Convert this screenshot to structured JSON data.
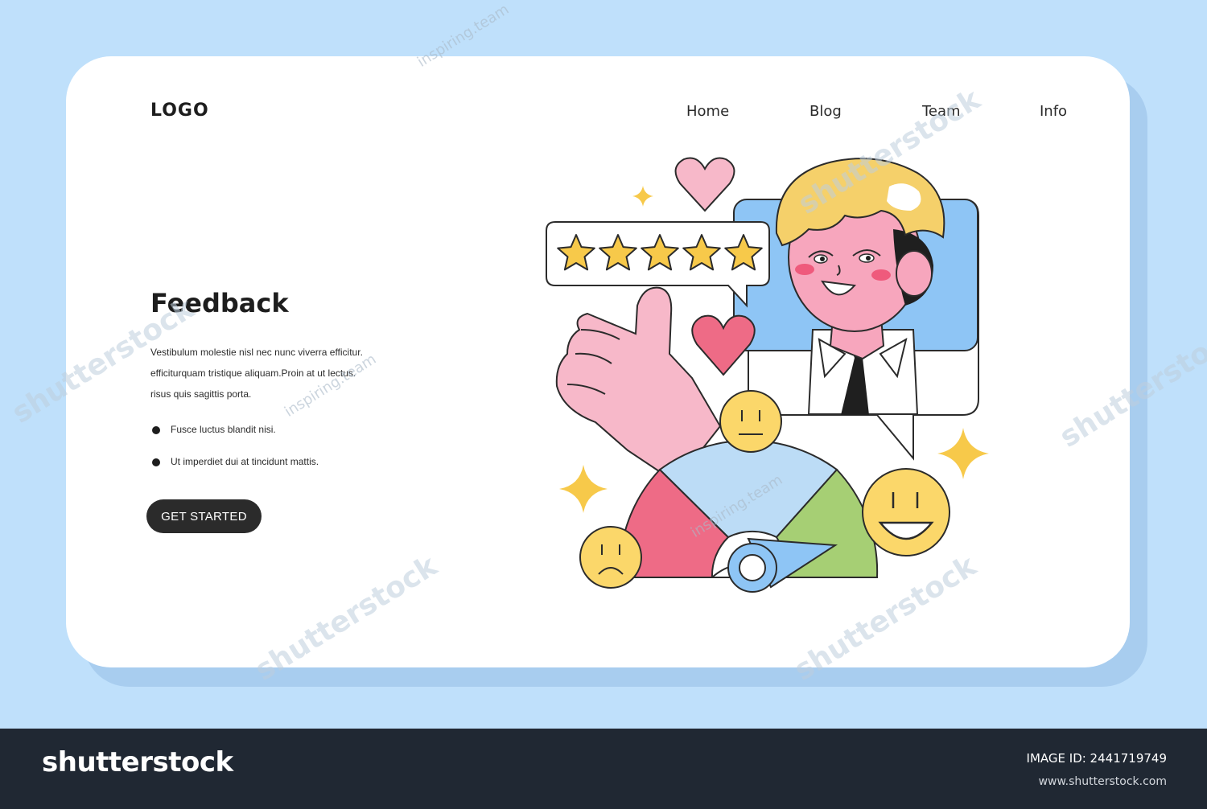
{
  "header": {
    "logo": "LOGO",
    "nav": [
      "Home",
      "Blog",
      "Team",
      "Info"
    ]
  },
  "hero": {
    "title": "Feedback",
    "paragraph_lines": [
      "Vestibulum molestie nisl nec nunc viverra efficitur.",
      "efficiturquam tristique aliquam.Proin at ut lectus.",
      "risus quis sagittis porta."
    ],
    "bullets": [
      "Fusce luctus blandit nisi.",
      "Ut imperdiet dui at tincidunt mattis."
    ],
    "cta_label": "GET STARTED"
  },
  "illustration": {
    "rating_stars": 5,
    "rating_max": 5,
    "icons": [
      "heart-icon",
      "star-icon",
      "thumbs-up-icon",
      "sad-face-icon",
      "neutral-face-icon",
      "happy-face-icon",
      "sparkle-icon"
    ],
    "colors": {
      "gauge_red": "#ee6b86",
      "gauge_blue": "#bcdcf6",
      "gauge_green": "#a6cf74",
      "heart_pink": "#f7b8c9",
      "heart_red": "#ee6b86",
      "star_yellow": "#f7c94a",
      "face_yellow": "#fbd76a",
      "skin_pink": "#f7a6bd",
      "hair_yellow": "#f5d06a",
      "bubble_blue": "#8ec5f5"
    }
  },
  "watermark": {
    "brand": "shutterstock",
    "tag": "inspiring.team"
  },
  "footer": {
    "brand": "shutterstock",
    "image_id": "IMAGE ID: 2441719749",
    "site": "www.shutterstock.com"
  }
}
